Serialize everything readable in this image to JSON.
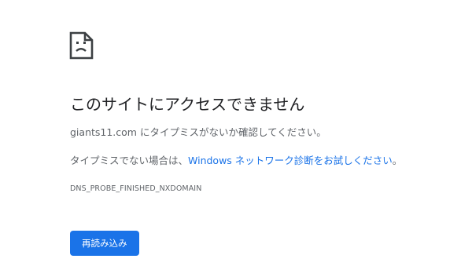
{
  "page": {
    "icon": "sad-page-icon",
    "headline": "このサイトにアクセスできません",
    "description": "giants11.com にタイプミスがないか確認してください。",
    "suggestion_prefix": "タイプミスでない場合は、",
    "suggestion_link": "Windows ネットワーク診断をお試しください",
    "suggestion_suffix": "。",
    "error_code": "DNS_PROBE_FINISHED_NXDOMAIN",
    "reload_label": "再読み込み"
  },
  "colors": {
    "accent": "#1a73e8",
    "text_primary": "#202124",
    "text_secondary": "#5f6368"
  }
}
